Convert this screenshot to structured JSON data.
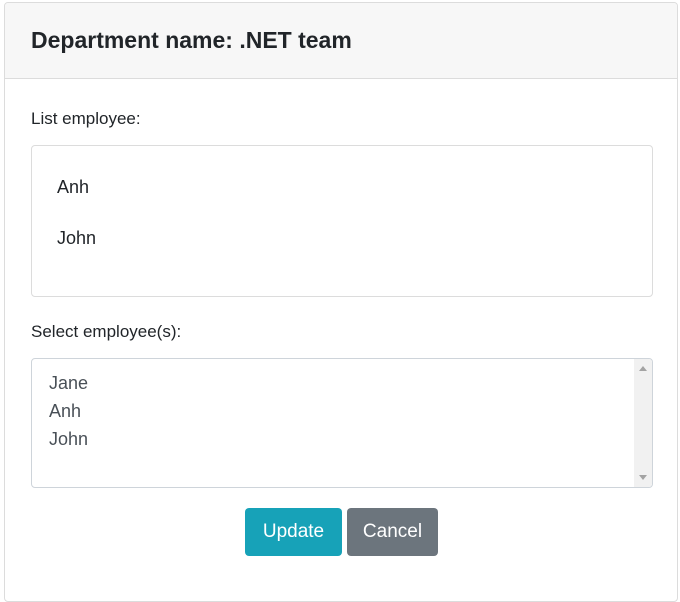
{
  "header": {
    "title": "Department name: .NET team"
  },
  "list_section": {
    "label": "List employee:",
    "items": [
      "Anh",
      "John"
    ]
  },
  "select_section": {
    "label": "Select employee(s):",
    "options": [
      "Jane",
      "Anh",
      "John"
    ]
  },
  "buttons": {
    "update_label": "Update",
    "cancel_label": "Cancel"
  },
  "colors": {
    "update": "#17a2b8",
    "cancel": "#6c757d",
    "header_bg": "#f7f7f7"
  },
  "icons": {
    "scroll_up": "scroll-up-arrow-icon",
    "scroll_down": "scroll-down-arrow-icon"
  }
}
